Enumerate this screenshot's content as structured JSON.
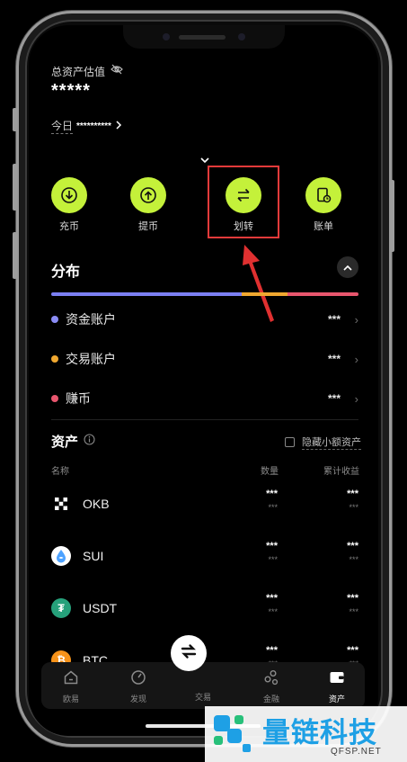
{
  "header": {
    "total_label": "总资产估值",
    "total_value": "*****",
    "today_label": "今日",
    "today_value": "**********"
  },
  "actions": [
    {
      "label": "充币",
      "icon": "deposit-icon"
    },
    {
      "label": "提币",
      "icon": "withdraw-icon"
    },
    {
      "label": "划转",
      "icon": "transfer-icon"
    },
    {
      "label": "账单",
      "icon": "bill-icon"
    }
  ],
  "distribution": {
    "title": "分布",
    "segments": [
      {
        "name": "资金账户",
        "color": "#7b7ff2",
        "fraction": 0.62
      },
      {
        "name": "交易账户",
        "color": "#f0a830",
        "fraction": 0.15
      },
      {
        "name": "赚币",
        "color": "#e8566e",
        "fraction": 0.23
      }
    ],
    "accounts": [
      {
        "name": "资金账户",
        "value": "***",
        "color": "#8b8cf5"
      },
      {
        "name": "交易账户",
        "value": "***",
        "color": "#f0a830"
      },
      {
        "name": "赚币",
        "value": "***",
        "color": "#e8566e"
      }
    ]
  },
  "assets": {
    "title": "资产",
    "hide_small_label": "隐藏小额资产",
    "col_name": "名称",
    "col_qty": "数量",
    "col_pnl": "累计收益",
    "rows": [
      {
        "symbol": "OKB",
        "qty": "***",
        "qty_sub": "***",
        "pnl": "***",
        "pnl_sub": "***",
        "color": "#000000"
      },
      {
        "symbol": "SUI",
        "qty": "***",
        "qty_sub": "***",
        "pnl": "***",
        "pnl_sub": "***",
        "color": "#4da2ff"
      },
      {
        "symbol": "USDT",
        "qty": "***",
        "qty_sub": "***",
        "pnl": "***",
        "pnl_sub": "***",
        "color": "#26a17b"
      },
      {
        "symbol": "BTC",
        "qty": "***",
        "qty_sub": "***",
        "pnl": "***",
        "pnl_sub": "***",
        "color": "#f7931a"
      }
    ]
  },
  "tabbar": {
    "tabs": [
      {
        "label": "欧易",
        "icon": "home-icon"
      },
      {
        "label": "发现",
        "icon": "discover-icon"
      },
      {
        "label": "交易",
        "icon": "trade-icon"
      },
      {
        "label": "金融",
        "icon": "finance-icon"
      },
      {
        "label": "资产",
        "icon": "wallet-icon"
      }
    ],
    "active": "资产"
  },
  "watermark": {
    "title": "量链科技",
    "url": "QFSP.NET"
  },
  "colors": {
    "accent": "#c4f13a",
    "highlight": "#e53a3a",
    "background": "#000000"
  }
}
